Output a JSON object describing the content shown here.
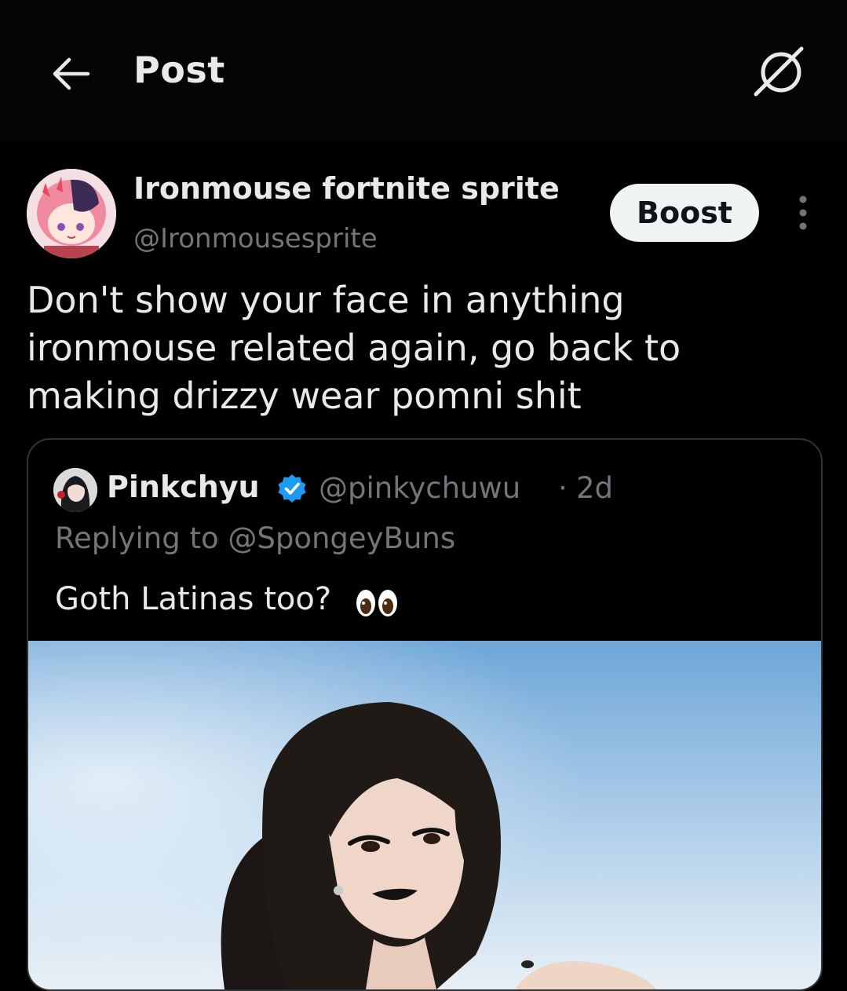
{
  "header": {
    "title": "Post",
    "back_icon": "arrow-left-icon",
    "grok_icon": "grok-icon"
  },
  "post": {
    "author_name": "Ironmouse fortnite sprite",
    "author_handle": "@Ironmousesprite",
    "boost_label": "Boost",
    "text": "Don't show your face in anything ironmouse related again, go back to making drizzy wear pomni shit"
  },
  "quote": {
    "author_name": "Pinkchyu",
    "verified": true,
    "author_handle": "@pinkychuwu",
    "separator": "·",
    "time": "2d",
    "replying_to": "Replying to @SpongeyBuns",
    "text": "Goth Latinas too?",
    "emoji": "eyes-emoji"
  },
  "colors": {
    "background": "#000000",
    "text_primary": "#e7e9ea",
    "text_secondary": "#71767b",
    "verified_blue": "#1d9bf0",
    "border": "#2f3336"
  }
}
